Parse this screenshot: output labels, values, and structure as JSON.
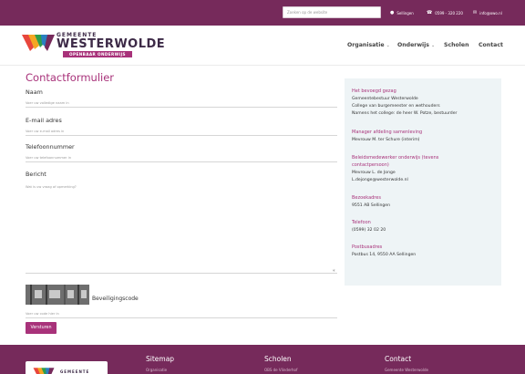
{
  "topbar": {
    "search_placeholder": "Zoeken op de website",
    "location": "Sellingen",
    "phone": "0599 - 320 220",
    "email": "info@owo.nl"
  },
  "logo": {
    "gemeente": "GEMEENTE",
    "name": "WESTERWOLDE",
    "sub": "OPENBAAR ONDERWIJS"
  },
  "nav": {
    "items": [
      {
        "label": "Organisatie",
        "has_dropdown": true
      },
      {
        "label": "Onderwijs",
        "has_dropdown": true
      },
      {
        "label": "Scholen",
        "has_dropdown": false
      },
      {
        "label": "Contact",
        "has_dropdown": false
      }
    ]
  },
  "form": {
    "title": "Contactformulier",
    "fields": [
      {
        "label": "Naam",
        "placeholder": "Voer uw volledige naam in"
      },
      {
        "label": "E-mail adres",
        "placeholder": "Voer uw e-mail adres in"
      },
      {
        "label": "Telefoonnummer",
        "placeholder": "Voer uw telefoonnummer in"
      },
      {
        "label": "Bericht",
        "placeholder": "Wat is uw vraag of opmerking?"
      }
    ],
    "captcha_label": "Beveiligingscode",
    "captcha_placeholder": "Voer uw code hier in",
    "submit_label": "Versturen"
  },
  "info": {
    "bevoegd_gezag_title": "Het bevoegd gezag",
    "bevoegd_gezag_lines": [
      "Gemeentebestuur Westerwolde",
      "College van burgemeester en wethouders",
      "Namens het college: de heer W. Potze, bestuurder"
    ],
    "manager_title": "Manager afdeling samenleving",
    "manager_lines": [
      "Mevrouw M. ter Schure (interim)"
    ],
    "beleid_title_1": "Beleidsmedewerker onderwijs (tevens",
    "beleid_title_2": "contactpersoon)",
    "beleid_lines": [
      "Mevrouw L. de Jonge",
      "L.dejonge@westerwolde.nl"
    ],
    "bezoek_title": "Bezoekadres",
    "bezoek_lines": [
      "9551 AB Sellingen"
    ],
    "telefoon_title": "Telefoon",
    "telefoon_lines": [
      "(0599) 32 02 20"
    ],
    "post_title": "Postbusadres",
    "post_lines": [
      "Postbus 14, 9550 AA Sellingen"
    ]
  },
  "footer": {
    "logo_text": "GEMEENTE",
    "sitemap_title": "Sitemap",
    "scholen_title": "Scholen",
    "contact_title": "Contact",
    "sitemap_first": "Organisatie",
    "scholen_first": "OBS de Vlinderhof",
    "contact_first": "Gemeente Westerwolde"
  },
  "colors": {
    "brand_purple": "#762a5b",
    "accent_magenta": "#a8327a",
    "panel_bg": "#eef4f6"
  }
}
